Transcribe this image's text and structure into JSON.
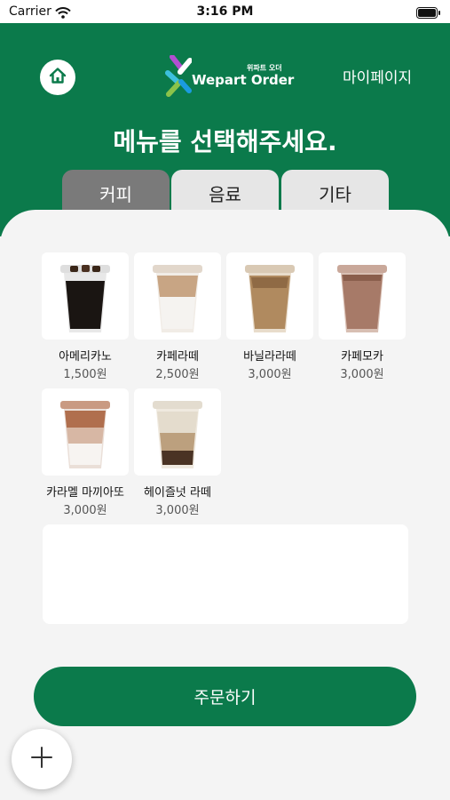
{
  "status_bar": {
    "carrier": "Carrier",
    "time": "3:16 PM"
  },
  "header": {
    "logo_small": "위파트 오더",
    "logo_text": "Wepart Order",
    "mypage_label": "마이페이지",
    "title": "메뉴를 선택해주세요."
  },
  "tabs": [
    {
      "label": "커피",
      "active": true
    },
    {
      "label": "음료",
      "active": false
    },
    {
      "label": "기타",
      "active": false
    }
  ],
  "menu": [
    {
      "name": "아메리카노",
      "price": "1,500원",
      "icon": "americano-cup"
    },
    {
      "name": "카페라떼",
      "price": "2,500원",
      "icon": "latte-cup"
    },
    {
      "name": "바닐라라떼",
      "price": "3,000원",
      "icon": "vanilla-latte-cup"
    },
    {
      "name": "카페모카",
      "price": "3,000원",
      "icon": "mocha-cup"
    },
    {
      "name": "카라멜 마끼아또",
      "price": "3,000원",
      "icon": "caramel-macchiato-cup"
    },
    {
      "name": "헤이즐넛 라떼",
      "price": "3,000원",
      "icon": "hazelnut-latte-cup"
    }
  ],
  "order_button_label": "주문하기",
  "colors": {
    "brand_green": "#0b7a4b",
    "tab_active": "#7a7a7a",
    "tab_inactive": "#e6e6e6"
  }
}
